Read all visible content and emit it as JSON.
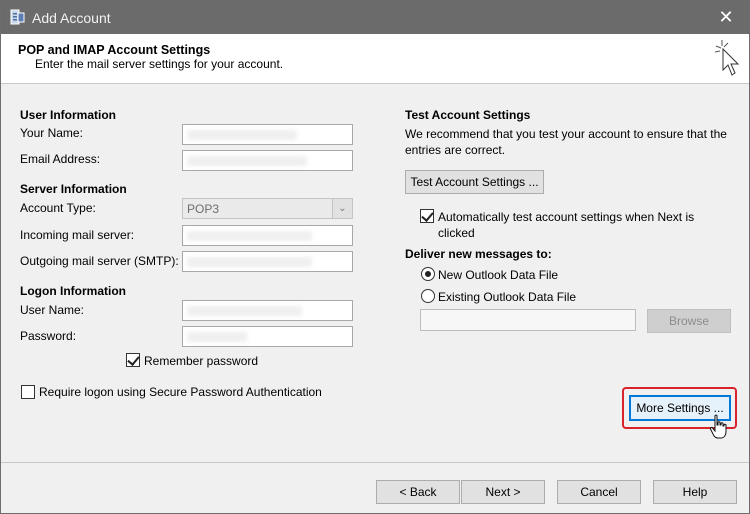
{
  "window": {
    "title": "Add Account"
  },
  "header": {
    "title": "POP and IMAP Account Settings",
    "subtitle": "Enter the mail server settings for your account."
  },
  "user_info": {
    "heading": "User Information",
    "name_label": "Your Name:",
    "email_label": "Email Address:"
  },
  "server_info": {
    "heading": "Server Information",
    "account_type_label": "Account Type:",
    "account_type_value": "POP3",
    "incoming_label": "Incoming mail server:",
    "outgoing_label": "Outgoing mail server (SMTP):"
  },
  "logon_info": {
    "heading": "Logon Information",
    "username_label": "User Name:",
    "password_label": "Password:",
    "remember_label": "Remember password",
    "remember_checked": true,
    "spa_label": "Require logon using Secure Password Authentication",
    "spa_checked": false
  },
  "test_settings": {
    "heading": "Test Account Settings",
    "description": "We recommend that you test your account to ensure that the entries are correct.",
    "button_label": "Test Account Settings ...",
    "auto_test_label": "Automatically test account settings when Next is clicked",
    "auto_test_checked": true
  },
  "deliver": {
    "heading": "Deliver new messages to:",
    "new_file_label": "New Outlook Data File",
    "existing_file_label": "Existing Outlook Data File",
    "browse_label": "Browse"
  },
  "more_settings_label": "More Settings ...",
  "footer": {
    "back_label": "< Back",
    "next_label": "Next >",
    "cancel_label": "Cancel",
    "help_label": "Help"
  },
  "colors": {
    "titlebar": "#6b6b6b",
    "focus": "#0078d7",
    "highlight": "#d9222a"
  }
}
